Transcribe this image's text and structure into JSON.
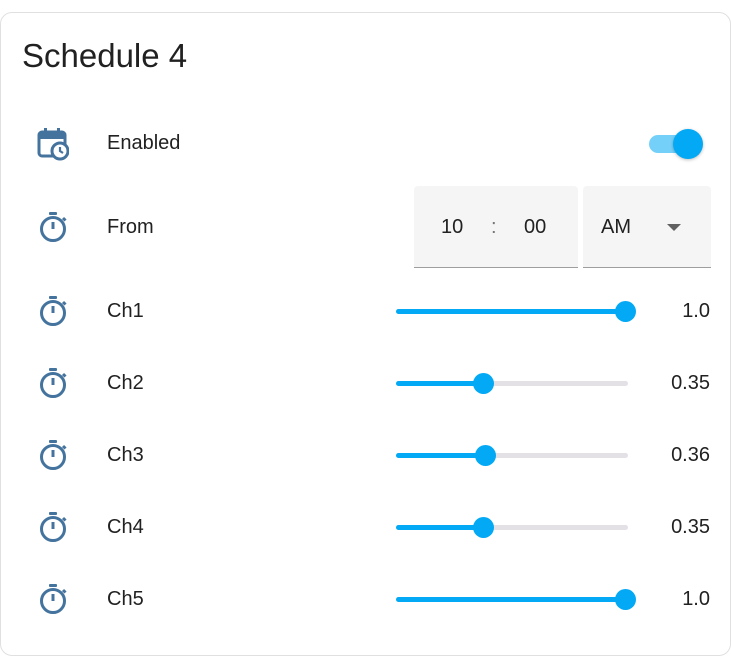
{
  "card": {
    "title": "Schedule 4"
  },
  "enabled": {
    "label": "Enabled",
    "on": true,
    "icon": "calendar-clock-icon"
  },
  "from": {
    "label": "From",
    "hour": "10",
    "separator": ":",
    "minute": "00",
    "period": "AM",
    "icon": "timer-icon"
  },
  "channels": [
    {
      "label": "Ch1",
      "value": "1.0",
      "level": 1.0
    },
    {
      "label": "Ch2",
      "value": "0.35",
      "level": 0.35
    },
    {
      "label": "Ch3",
      "value": "0.36",
      "level": 0.36
    },
    {
      "label": "Ch4",
      "value": "0.35",
      "level": 0.35
    },
    {
      "label": "Ch5",
      "value": "1.0",
      "level": 1.0
    }
  ],
  "colors": {
    "accent": "#03a9f4",
    "icon": "#44739e",
    "rail": "#e3e0e6"
  }
}
